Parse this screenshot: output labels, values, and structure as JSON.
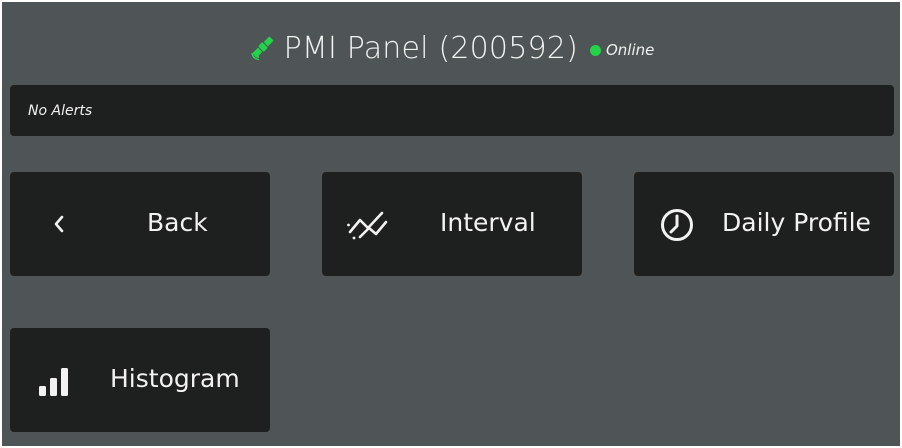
{
  "header": {
    "title": "PMI Panel (200592)",
    "status": "Online",
    "status_color": "#23d34a",
    "icon": "satellite-icon",
    "icon_color": "#23d34a"
  },
  "alerts": {
    "text": "No Alerts"
  },
  "buttons": {
    "back": {
      "label": "Back",
      "icon": "chevron-left-icon"
    },
    "interval": {
      "label": "Interval",
      "icon": "trend-lines-icon"
    },
    "daily_profile": {
      "label": "Daily Profile",
      "icon": "clock-icon"
    },
    "histogram": {
      "label": "Histogram",
      "icon": "bar-chart-icon"
    }
  },
  "colors": {
    "background": "#4f5556",
    "panel": "#1e1f1f",
    "text": "#f2f2f2"
  }
}
